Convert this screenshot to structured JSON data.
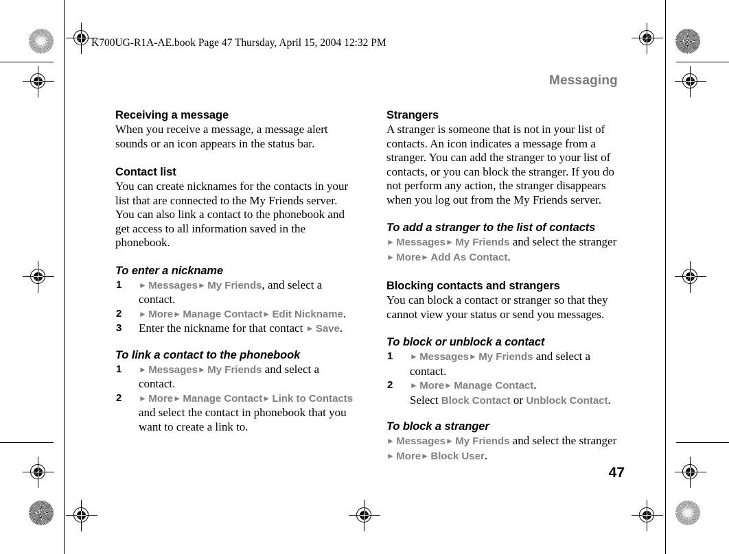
{
  "page": {
    "filestamp": "K700UG-R1A-AE.book  Page 47  Thursday, April 15, 2004  12:32 PM",
    "running_head": "Messaging",
    "folio": "47",
    "arrow_glyph": "►",
    "ui_token_color": "#808080"
  },
  "left_column": {
    "receiving": {
      "heading": "Receiving a message",
      "body": "When you receive a message, a message alert sounds or an icon appears in the status bar."
    },
    "contact_list": {
      "heading": "Contact list",
      "body": "You can create nicknames for the contacts in your list that are connected to the My Friends server. You can also link a contact to the phonebook and get access to all information saved in the phonebook."
    },
    "enter_nickname": {
      "heading": "To enter a nickname",
      "steps": [
        {
          "parts": [
            {
              "t": "arrow"
            },
            {
              "t": "ui",
              "v": "Messages"
            },
            {
              "t": "arrow"
            },
            {
              "t": "ui",
              "v": "My Friends"
            },
            {
              "t": "text",
              "v": ", and select a contact."
            }
          ]
        },
        {
          "parts": [
            {
              "t": "arrow"
            },
            {
              "t": "ui",
              "v": "More"
            },
            {
              "t": "arrow"
            },
            {
              "t": "ui",
              "v": "Manage Contact"
            },
            {
              "t": "arrow"
            },
            {
              "t": "ui",
              "v": "Edit Nickname"
            },
            {
              "t": "text",
              "v": "."
            }
          ]
        },
        {
          "parts": [
            {
              "t": "text",
              "v": "Enter the nickname for that contact "
            },
            {
              "t": "arrow"
            },
            {
              "t": "ui",
              "v": "Save"
            },
            {
              "t": "text",
              "v": "."
            }
          ]
        }
      ]
    },
    "link_contact": {
      "heading": "To link a contact to the phonebook",
      "steps": [
        {
          "parts": [
            {
              "t": "arrow"
            },
            {
              "t": "ui",
              "v": "Messages"
            },
            {
              "t": "arrow"
            },
            {
              "t": "ui",
              "v": "My Friends"
            },
            {
              "t": "text",
              "v": " and select a contact."
            }
          ]
        },
        {
          "parts": [
            {
              "t": "arrow"
            },
            {
              "t": "ui",
              "v": "More"
            },
            {
              "t": "arrow"
            },
            {
              "t": "ui",
              "v": "Manage Contact"
            },
            {
              "t": "arrow"
            },
            {
              "t": "ui",
              "v": "Link to Contacts"
            },
            {
              "t": "text",
              "v": " and select the contact in phonebook that you want to create a link to."
            }
          ]
        }
      ]
    }
  },
  "right_column": {
    "strangers": {
      "heading": "Strangers",
      "body": "A stranger is someone that is not in your list of contacts. An icon indicates a message from a stranger. You can add the stranger to your list of contacts, or you can block the stranger. If you do not perform any action, the stranger disappears when you log out from the My Friends server."
    },
    "add_stranger": {
      "heading": "To add a stranger to the list of contacts",
      "lines": [
        {
          "parts": [
            {
              "t": "arrow"
            },
            {
              "t": "ui",
              "v": "Messages"
            },
            {
              "t": "arrow"
            },
            {
              "t": "ui",
              "v": "My Friends"
            },
            {
              "t": "text",
              "v": " and select the stranger"
            }
          ]
        },
        {
          "parts": [
            {
              "t": "arrow"
            },
            {
              "t": "ui",
              "v": "More"
            },
            {
              "t": "arrow"
            },
            {
              "t": "ui",
              "v": "Add As Contact"
            },
            {
              "t": "text",
              "v": "."
            }
          ]
        }
      ]
    },
    "blocking": {
      "heading": "Blocking contacts and strangers",
      "body": "You can block a contact or stranger so that they cannot view your status or send you messages."
    },
    "block_contact": {
      "heading": "To block or unblock a contact",
      "steps": [
        {
          "parts": [
            {
              "t": "arrow"
            },
            {
              "t": "ui",
              "v": "Messages"
            },
            {
              "t": "arrow"
            },
            {
              "t": "ui",
              "v": "My Friends"
            },
            {
              "t": "text",
              "v": " and select a contact."
            }
          ]
        },
        {
          "parts": [
            {
              "t": "arrow"
            },
            {
              "t": "ui",
              "v": "More"
            },
            {
              "t": "arrow"
            },
            {
              "t": "ui",
              "v": "Manage Contact"
            },
            {
              "t": "text",
              "v": "."
            },
            {
              "t": "break"
            },
            {
              "t": "text",
              "v": "Select "
            },
            {
              "t": "ui",
              "v": "Block Contact"
            },
            {
              "t": "text",
              "v": " or "
            },
            {
              "t": "ui",
              "v": "Unblock Contact"
            },
            {
              "t": "text",
              "v": "."
            }
          ]
        }
      ]
    },
    "block_stranger": {
      "heading": "To block a stranger",
      "lines": [
        {
          "parts": [
            {
              "t": "arrow"
            },
            {
              "t": "ui",
              "v": "Messages"
            },
            {
              "t": "arrow"
            },
            {
              "t": "ui",
              "v": "My Friends"
            },
            {
              "t": "text",
              "v": " and select the stranger"
            }
          ]
        },
        {
          "parts": [
            {
              "t": "arrow"
            },
            {
              "t": "ui",
              "v": "More"
            },
            {
              "t": "arrow"
            },
            {
              "t": "ui",
              "v": "Block User"
            },
            {
              "t": "text",
              "v": "."
            }
          ]
        }
      ]
    }
  }
}
